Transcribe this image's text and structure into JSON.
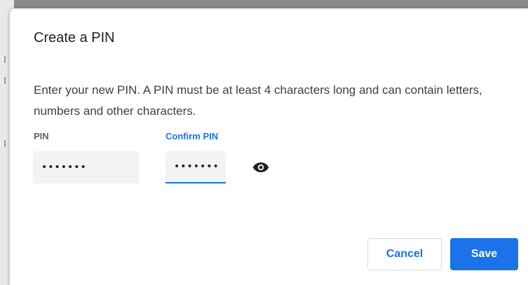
{
  "dialog": {
    "title": "Create a PIN",
    "description": "Enter your new PIN. A PIN must be at least 4 characters long and can contain letters, numbers and other characters."
  },
  "fields": {
    "pin": {
      "label": "PIN",
      "value": "1234567"
    },
    "confirm_pin": {
      "label": "Confirm PIN",
      "value": "1234567"
    }
  },
  "icons": {
    "show_pin": "eye-icon"
  },
  "buttons": {
    "cancel_label": "Cancel",
    "save_label": "Save"
  },
  "colors": {
    "accent": "#1a73e8",
    "field_background": "#f1f3f4"
  }
}
